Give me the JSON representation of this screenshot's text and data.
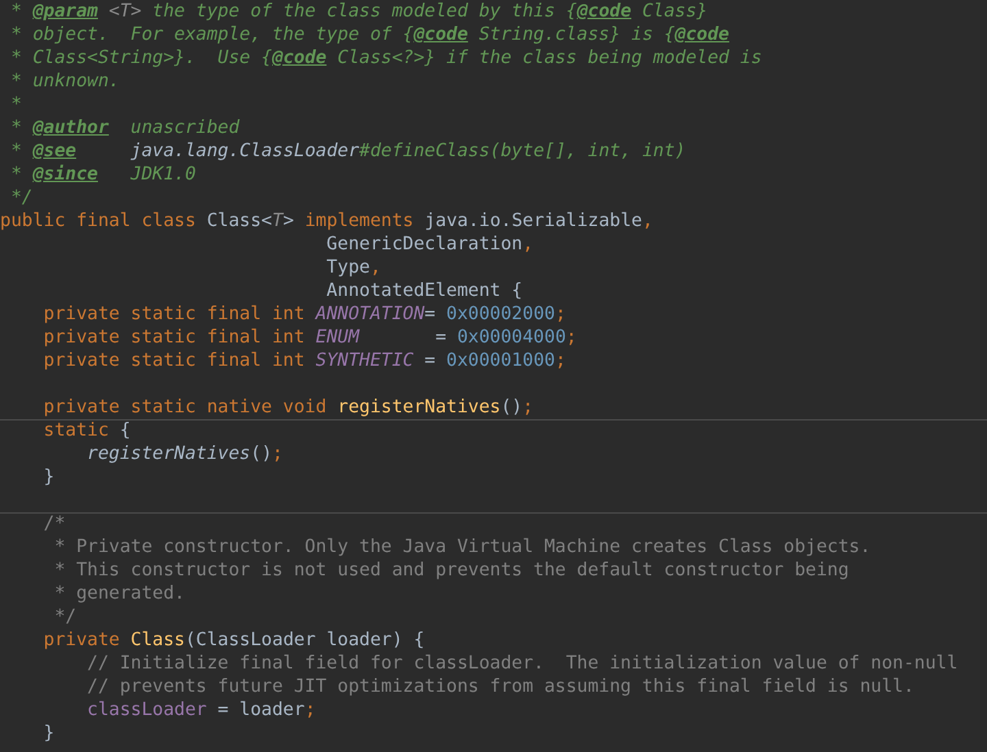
{
  "editor": {
    "lines": [
      {
        "divider_above": false,
        "tokens": [
          {
            "kind": "doc",
            "text": " * "
          },
          {
            "kind": "tag",
            "text": "@param"
          },
          {
            "kind": "param",
            "text": " <T>"
          },
          {
            "kind": "doc",
            "text": " the type of the class modeled by this {"
          },
          {
            "kind": "tag",
            "text": "@code"
          },
          {
            "kind": "doc",
            "text": " Class}"
          }
        ]
      },
      {
        "divider_above": false,
        "tokens": [
          {
            "kind": "doc",
            "text": " * object.  For example, the type of {"
          },
          {
            "kind": "tag",
            "text": "@code"
          },
          {
            "kind": "doc",
            "text": " String.class} is {"
          },
          {
            "kind": "tag",
            "text": "@code"
          }
        ]
      },
      {
        "divider_above": false,
        "tokens": [
          {
            "kind": "doc",
            "text": " * Class<String>}.  Use {"
          },
          {
            "kind": "tag",
            "text": "@code"
          },
          {
            "kind": "doc",
            "text": " Class<?>} if the class being modeled is"
          }
        ]
      },
      {
        "divider_above": false,
        "tokens": [
          {
            "kind": "doc",
            "text": " * unknown."
          }
        ]
      },
      {
        "divider_above": false,
        "tokens": [
          {
            "kind": "doc",
            "text": " *"
          }
        ]
      },
      {
        "divider_above": false,
        "tokens": [
          {
            "kind": "doc",
            "text": " * "
          },
          {
            "kind": "tag",
            "text": "@author"
          },
          {
            "kind": "doc",
            "text": "  unascribed"
          }
        ]
      },
      {
        "divider_above": false,
        "tokens": [
          {
            "kind": "doc",
            "text": " * "
          },
          {
            "kind": "tag",
            "text": "@see"
          },
          {
            "kind": "ref",
            "text": "     java.lang.ClassLoader"
          },
          {
            "kind": "doc",
            "text": "#defineClass(byte[], int, int)"
          }
        ]
      },
      {
        "divider_above": false,
        "tokens": [
          {
            "kind": "doc",
            "text": " * "
          },
          {
            "kind": "tag",
            "text": "@since"
          },
          {
            "kind": "doc",
            "text": "   JDK1.0"
          }
        ]
      },
      {
        "divider_above": false,
        "tokens": [
          {
            "kind": "doc",
            "text": " */"
          }
        ]
      },
      {
        "divider_above": false,
        "tokens": [
          {
            "kind": "keyword",
            "text": "public final class "
          },
          {
            "kind": "plain",
            "text": "Class<"
          },
          {
            "kind": "param",
            "text": "T"
          },
          {
            "kind": "plain",
            "text": "> "
          },
          {
            "kind": "keyword",
            "text": "implements "
          },
          {
            "kind": "plain",
            "text": "java.io.Serializable"
          },
          {
            "kind": "keyword",
            "text": ","
          }
        ]
      },
      {
        "divider_above": false,
        "tokens": [
          {
            "kind": "plain",
            "text": "                              GenericDeclaration"
          },
          {
            "kind": "keyword",
            "text": ","
          }
        ]
      },
      {
        "divider_above": false,
        "tokens": [
          {
            "kind": "plain",
            "text": "                              Type"
          },
          {
            "kind": "keyword",
            "text": ","
          }
        ]
      },
      {
        "divider_above": false,
        "tokens": [
          {
            "kind": "plain",
            "text": "                              AnnotatedElement {"
          }
        ]
      },
      {
        "divider_above": false,
        "tokens": [
          {
            "kind": "keyword",
            "text": "    private static final int "
          },
          {
            "kind": "constant",
            "text": "ANNOTATION"
          },
          {
            "kind": "plain",
            "text": "= "
          },
          {
            "kind": "number",
            "text": "0x00002000"
          },
          {
            "kind": "keyword",
            "text": ";"
          }
        ]
      },
      {
        "divider_above": false,
        "tokens": [
          {
            "kind": "keyword",
            "text": "    private static final int "
          },
          {
            "kind": "constant",
            "text": "ENUM"
          },
          {
            "kind": "plain",
            "text": "       = "
          },
          {
            "kind": "number",
            "text": "0x00004000"
          },
          {
            "kind": "keyword",
            "text": ";"
          }
        ]
      },
      {
        "divider_above": false,
        "tokens": [
          {
            "kind": "keyword",
            "text": "    private static final int "
          },
          {
            "kind": "constant",
            "text": "SYNTHETIC"
          },
          {
            "kind": "plain",
            "text": " = "
          },
          {
            "kind": "number",
            "text": "0x00001000"
          },
          {
            "kind": "keyword",
            "text": ";"
          }
        ]
      },
      {
        "divider_above": false
      },
      {
        "divider_above": false,
        "tokens": [
          {
            "kind": "keyword",
            "text": "    private static native void "
          },
          {
            "kind": "method",
            "text": "registerNatives"
          },
          {
            "kind": "plain",
            "text": "()"
          },
          {
            "kind": "keyword",
            "text": ";"
          }
        ]
      },
      {
        "divider_above": true,
        "tokens": [
          {
            "kind": "keyword",
            "text": "    static "
          },
          {
            "kind": "plain",
            "text": "{"
          }
        ]
      },
      {
        "divider_above": false,
        "tokens": [
          {
            "kind": "call",
            "text": "        registerNatives"
          },
          {
            "kind": "plain",
            "text": "()"
          },
          {
            "kind": "keyword",
            "text": ";"
          }
        ]
      },
      {
        "divider_above": false,
        "tokens": [
          {
            "kind": "plain",
            "text": "    }"
          }
        ]
      },
      {
        "divider_above": false
      },
      {
        "divider_above": true,
        "tokens": [
          {
            "kind": "comment",
            "text": "    /*"
          }
        ]
      },
      {
        "divider_above": false,
        "tokens": [
          {
            "kind": "comment",
            "text": "     * Private constructor. Only the Java Virtual Machine creates Class objects."
          }
        ]
      },
      {
        "divider_above": false,
        "tokens": [
          {
            "kind": "comment",
            "text": "     * This constructor is not used and prevents the default constructor being"
          }
        ]
      },
      {
        "divider_above": false,
        "tokens": [
          {
            "kind": "comment",
            "text": "     * generated."
          }
        ]
      },
      {
        "divider_above": false,
        "tokens": [
          {
            "kind": "comment",
            "text": "     */"
          }
        ]
      },
      {
        "divider_above": false,
        "tokens": [
          {
            "kind": "keyword",
            "text": "    private "
          },
          {
            "kind": "method",
            "text": "Class"
          },
          {
            "kind": "plain",
            "text": "(ClassLoader loader) {"
          }
        ]
      },
      {
        "divider_above": false,
        "tokens": [
          {
            "kind": "comment",
            "text": "        // Initialize final field for classLoader.  The initialization value of non-null"
          }
        ]
      },
      {
        "divider_above": false,
        "tokens": [
          {
            "kind": "comment",
            "text": "        // prevents future JIT optimizations from assuming this final field is null."
          }
        ]
      },
      {
        "divider_above": false,
        "tokens": [
          {
            "kind": "field",
            "text": "        classLoader"
          },
          {
            "kind": "plain",
            "text": " = loader"
          },
          {
            "kind": "keyword",
            "text": ";"
          }
        ]
      },
      {
        "divider_above": false,
        "tokens": [
          {
            "kind": "plain",
            "text": "    }"
          }
        ]
      }
    ]
  }
}
